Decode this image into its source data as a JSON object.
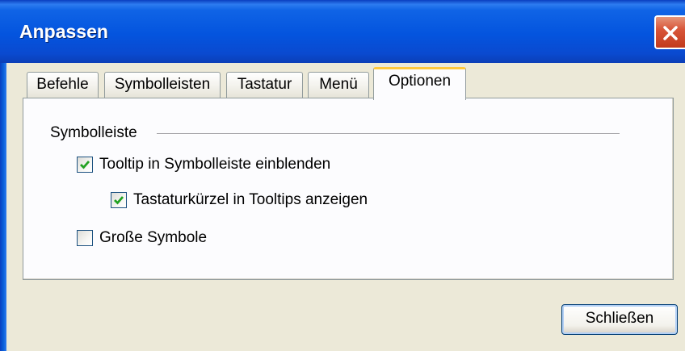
{
  "window": {
    "title": "Anpassen"
  },
  "tabs": [
    {
      "label": "Befehle",
      "active": false
    },
    {
      "label": "Symbolleisten",
      "active": false
    },
    {
      "label": "Tastatur",
      "active": false
    },
    {
      "label": "Menü",
      "active": false
    },
    {
      "label": "Optionen",
      "active": true
    }
  ],
  "options": {
    "group_label": "Symbolleiste",
    "checkboxes": [
      {
        "label": "Tooltip in Symbolleiste einblenden",
        "checked": true
      },
      {
        "label": "Tastaturkürzel in Tooltips anzeigen",
        "checked": true
      },
      {
        "label": "Große Symbole",
        "checked": false
      }
    ]
  },
  "footer": {
    "close_label": "Schließen"
  },
  "colors": {
    "titlebar": "#0454de",
    "checkmark": "#21a121",
    "active_tab_highlight": "#ffc83c",
    "close_button": "#d8563a"
  },
  "icons": {
    "close": "close-icon",
    "check": "check-icon"
  }
}
